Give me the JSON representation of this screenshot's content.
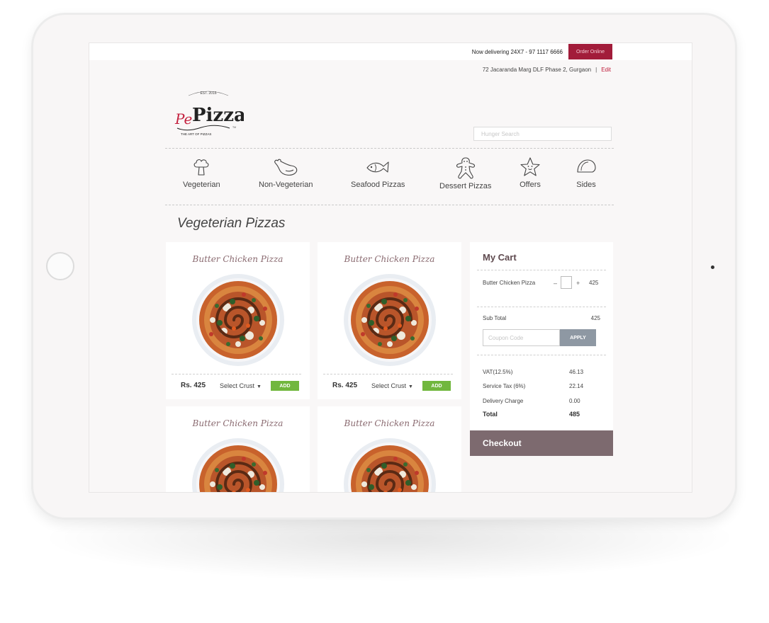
{
  "header": {
    "delivery_text": "Now delivering 24X7 - 97 1117 6666",
    "order_online_label": "Order Online",
    "address": "72 Jacaranda Marg DLF Phase 2, Gurgaon",
    "separator": "|",
    "edit_label": "Edit"
  },
  "logo": {
    "est": "EST. 2016",
    "brand_prefix": "Pe",
    "brand_main": "Pizza",
    "tagline": "THE ART OF PIZZAS",
    "tm": "TM"
  },
  "search": {
    "placeholder": "Hunger Search"
  },
  "categories": [
    {
      "label": "Vegeterian",
      "icon": "broccoli-icon"
    },
    {
      "label": "Non-Vegeterian",
      "icon": "chicken-leg-icon"
    },
    {
      "label": "Seafood Pizzas",
      "icon": "fish-icon"
    },
    {
      "label": "Dessert Pizzas",
      "icon": "gingerbread-icon"
    },
    {
      "label": "Offers",
      "icon": "star-icon"
    },
    {
      "label": "Sides",
      "icon": "taco-icon"
    }
  ],
  "section_title": "Vegeterian Pizzas",
  "products": [
    {
      "name": "Butter Chicken Pizza",
      "price": "Rs. 425",
      "crust_label": "Select Crust",
      "add_label": "ADD"
    },
    {
      "name": "Butter Chicken Pizza",
      "price": "Rs. 425",
      "crust_label": "Select Crust",
      "add_label": "ADD"
    },
    {
      "name": "Butter Chicken Pizza"
    },
    {
      "name": "Butter Chicken Pizza"
    }
  ],
  "cart": {
    "title": "My Cart",
    "item": {
      "name": "Butter Chicken Pizza",
      "minus": "–",
      "plus": "+",
      "price": "425"
    },
    "subtotal_label": "Sub Total",
    "subtotal_value": "425",
    "coupon_placeholder": "Coupon Code",
    "apply_label": "APPLY",
    "vat_label": "VAT(12.5%)",
    "vat_value": "46.13",
    "service_tax_label": "Service Tax (6%)",
    "service_tax_value": "22.14",
    "delivery_label": "Delivery Charge",
    "delivery_value": "0.00",
    "total_label": "Total",
    "total_value": "485",
    "checkout_label": "Checkout"
  },
  "colors": {
    "brand": "#a21c3a",
    "add_green": "#71b73e",
    "checkout": "#7d6a6f",
    "apply": "#8e98a3"
  }
}
